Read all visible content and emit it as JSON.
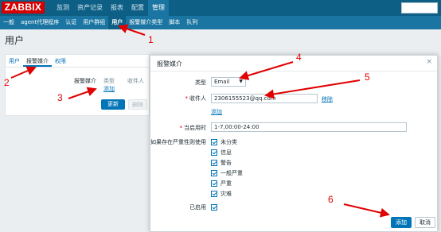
{
  "logo": "ZABBIX",
  "main_menu": [
    {
      "label": "监测",
      "active": false
    },
    {
      "label": "资产记录",
      "active": false
    },
    {
      "label": "报表",
      "active": false
    },
    {
      "label": "配置",
      "active": false
    },
    {
      "label": "管理",
      "active": true
    }
  ],
  "sub_menu": [
    {
      "label": "一般",
      "active": false
    },
    {
      "label": "agent代理程序",
      "active": false
    },
    {
      "label": "认证",
      "active": false
    },
    {
      "label": "用户群组",
      "active": false
    },
    {
      "label": "用户",
      "active": true
    },
    {
      "label": "报警媒介类型",
      "active": false
    },
    {
      "label": "脚本",
      "active": false
    },
    {
      "label": "队列",
      "active": false
    }
  ],
  "page_title": "用户",
  "bg_panel": {
    "tabs": [
      "用户",
      "报警媒介",
      "权限"
    ],
    "field_label": "报警媒介",
    "col_type": "类型",
    "col_recipient": "收件人",
    "add_link": "添加",
    "update_button": "更新",
    "delete_button": "删除"
  },
  "dialog": {
    "title": "报警媒介",
    "close": "×",
    "type_label": "类型",
    "type_value": "Email",
    "recipient_label": "收件人",
    "recipient_value": "2306155523@qq.com",
    "remove_link": "移除",
    "add_link": "添加",
    "when_active_label": "当启用时",
    "when_active_value": "1-7,00:00-24:00",
    "severity_label": "如果存在严重性则使用",
    "severities": [
      "未分类",
      "信息",
      "警告",
      "一般严重",
      "严重",
      "灾难"
    ],
    "enabled_label": "已启用",
    "add_button": "添加",
    "cancel_button": "取消"
  },
  "annotations": [
    "1",
    "2",
    "3",
    "4",
    "5",
    "6"
  ],
  "colors": {
    "annotation": "#e00000",
    "top_bar": "#0e5f85",
    "sub_bar": "#1a75a2",
    "logo": "#d40000",
    "primary_button": "#0275b8"
  }
}
